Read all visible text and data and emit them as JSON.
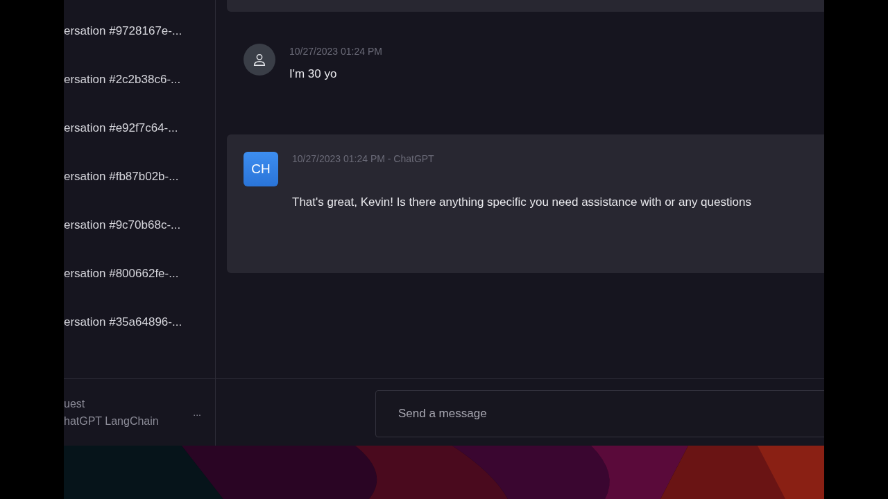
{
  "sidebar": {
    "conversations": [
      {
        "title": "ersation #9728167e-..."
      },
      {
        "title": "ersation #2c2b38c6-..."
      },
      {
        "title": "ersation #e92f7c64-..."
      },
      {
        "title": "ersation #fb87b02b-..."
      },
      {
        "title": "ersation #9c70b68c-..."
      },
      {
        "title": "ersation #800662fe-..."
      },
      {
        "title": "ersation #35a64896-..."
      }
    ],
    "account": {
      "name": "uest",
      "subtitle": "hatGPT LangChain",
      "menu": "..."
    }
  },
  "messages": [
    {
      "kind": "user",
      "header": "10/27/2023 01:24 PM",
      "text": "I'm 30 yo"
    },
    {
      "kind": "assistant",
      "avatar": "CH",
      "header": "10/27/2023 01:24 PM - ChatGPT",
      "text": "That's great, Kevin! Is there anything specific you need assistance with or any questions"
    }
  ],
  "composer": {
    "placeholder": "Send a message"
  }
}
